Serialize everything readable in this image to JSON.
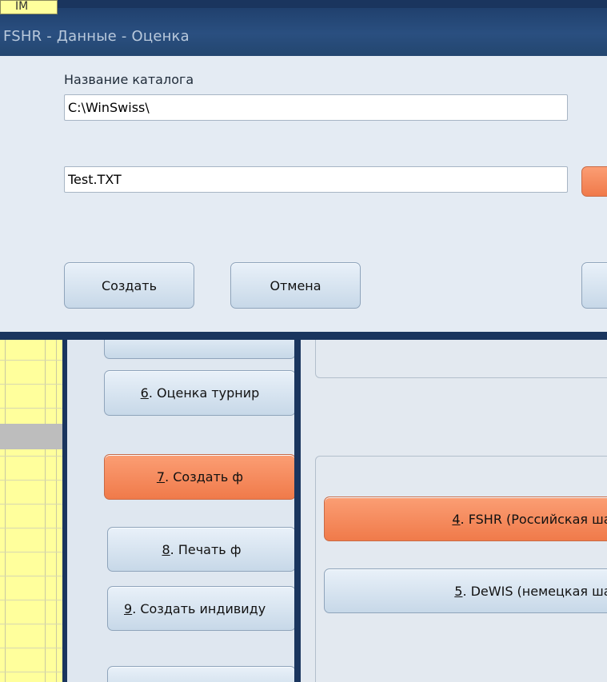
{
  "background": {
    "sheet_tab_label": "IM",
    "left_buttons": [
      {
        "label": ""
      },
      {
        "accel": "6",
        "rest": ". Оценка турнир"
      },
      {
        "accel": "7",
        "rest": ". Создать ф"
      },
      {
        "accel": "8",
        "rest": ". Печать ф"
      },
      {
        "accel": "9",
        "rest": ". Создать индивиду"
      },
      {
        "label": ""
      }
    ],
    "right_buttons": [
      {
        "accel": "4",
        "rest": ". FSHR (Российская шах"
      },
      {
        "accel": "5",
        "rest": ". DeWIS (немецкая шах"
      }
    ]
  },
  "dialog": {
    "title": "FSHR - Данные - Оценка",
    "catalog_label": "Название каталога",
    "catalog_value": "C:\\WinSwiss\\",
    "file_value": "Test.TXT",
    "create_button": "Создать",
    "cancel_button": "Отмена"
  },
  "colors": {
    "accent_orange": "#f07a4a",
    "frame_navy": "#1a355e",
    "sheet_yellow": "#ffff9c"
  }
}
